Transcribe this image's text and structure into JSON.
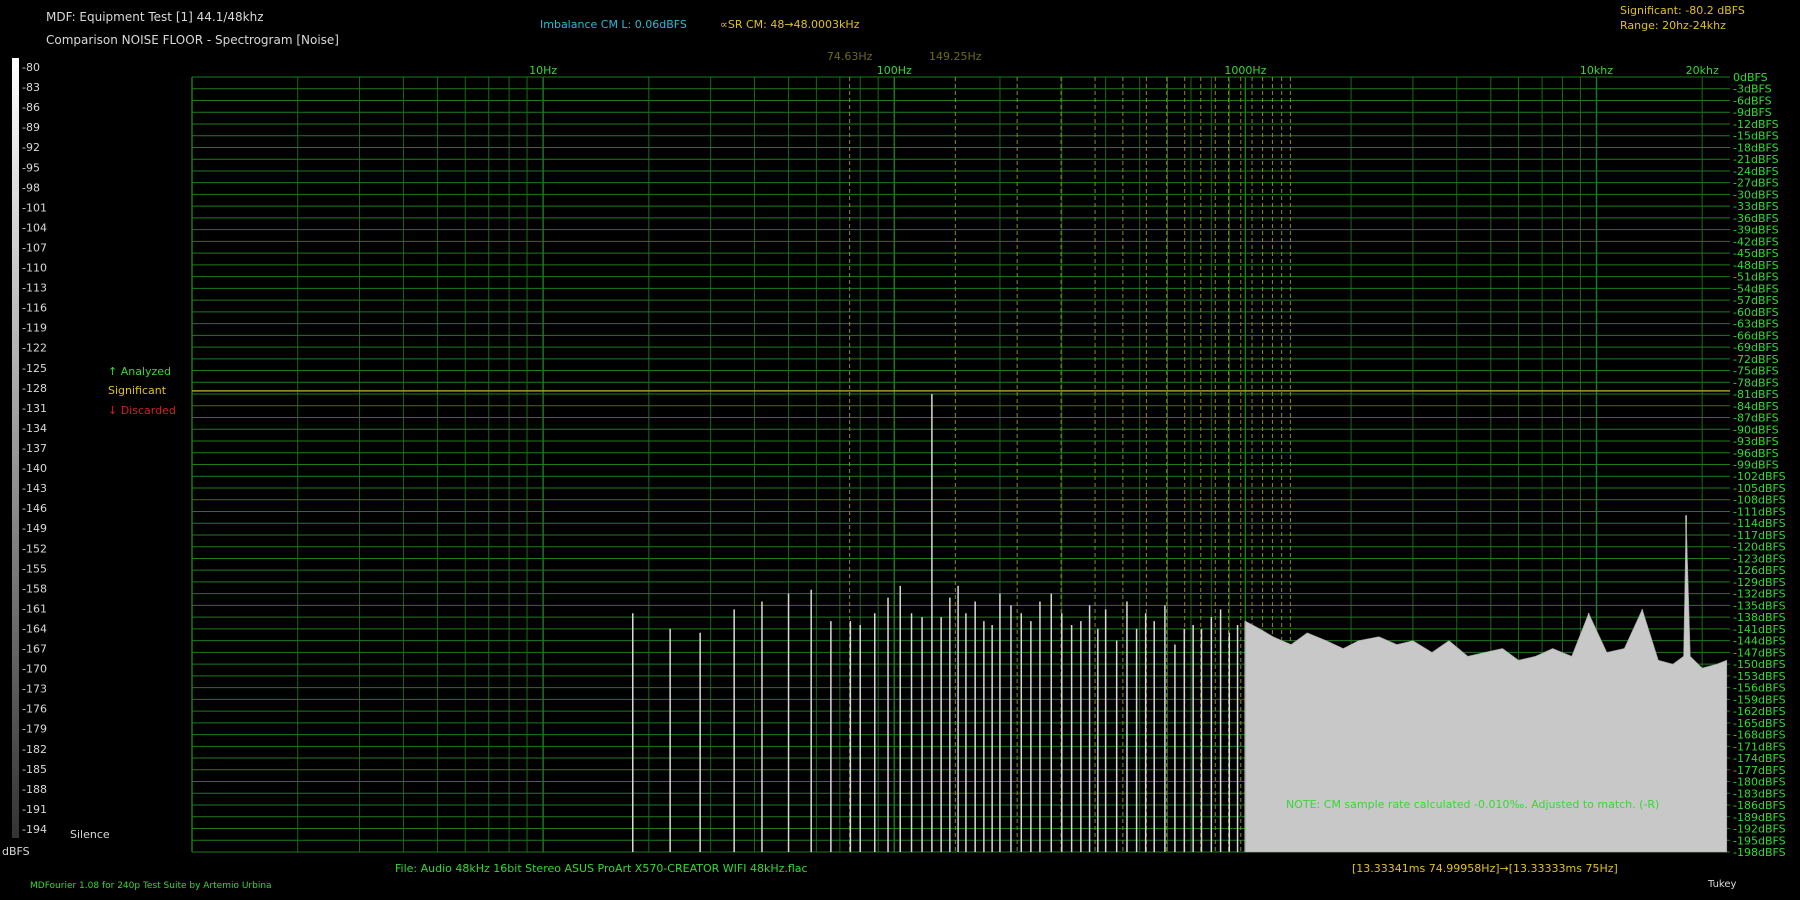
{
  "header": {
    "title": "MDF: Equipment Test [1] 44.1/48khz",
    "subtitle": "Comparison NOISE FLOOR - Spectrogram [Noise]",
    "imbalance": "Imbalance CM L: 0.06dBFS",
    "sr_cm": "∝SR CM: 48→48.0003kHz",
    "significant": "Significant: -80.2 dBFS",
    "range": "Range: 20hz-24khz"
  },
  "legend": {
    "analyzed": "↑ Analyzed",
    "significant": "Significant",
    "discarded": "↓ Discarded",
    "silence": "Silence",
    "unit": "dBFS"
  },
  "footer": {
    "file": "File: Audio   48kHz 16bit Stereo ASUS ProArt X570-CREATOR WIFI 48kHz.flac",
    "range": "[13.33341ms 74.99958Hz]→[13.33333ms 75Hz]",
    "credit": "MDFourier 1.08 for 240p Test Suite by Artemio Urbina",
    "window": "Tukey",
    "note": "NOTE: CM sample rate calculated -0.010‰. Adjusted to match. (-R)"
  },
  "colors": {
    "grid": "#1f7a1f",
    "grid_label": "#34d934",
    "marker": "#8c8c1a",
    "marker_label": "#6b6b14",
    "significant_line": "#a89a2a",
    "bars": "#d9d9d9",
    "title": "#d9d9d9",
    "cyan": "#2fb7d6",
    "yellow": "#e0c020",
    "red": "#d02020"
  },
  "chart_data": {
    "type": "bar",
    "x_scale": "log",
    "xlim": [
      1,
      24000
    ],
    "ylim": [
      -198,
      0
    ],
    "x_tick_labels": [
      {
        "value": 10,
        "label": "10Hz"
      },
      {
        "value": 100,
        "label": "100Hz"
      },
      {
        "value": 1000,
        "label": "1000Hz"
      },
      {
        "value": 10000,
        "label": "10khz"
      },
      {
        "value": 20000,
        "label": "20khz"
      }
    ],
    "marker_labels": [
      {
        "value": 74.63,
        "label": "74.63Hz"
      },
      {
        "value": 149.25,
        "label": "149.25Hz"
      }
    ],
    "significant_level": -80.2,
    "y_right_ticks": [
      "0dBFS",
      "-3dBFS",
      "-6dBFS",
      "-9dBFS",
      "-12dBFS",
      "-15dBFS",
      "-18dBFS",
      "-21dBFS",
      "-24dBFS",
      "-27dBFS",
      "-30dBFS",
      "-33dBFS",
      "-36dBFS",
      "-39dBFS",
      "-42dBFS",
      "-45dBFS",
      "-48dBFS",
      "-51dBFS",
      "-54dBFS",
      "-57dBFS",
      "-60dBFS",
      "-63dBFS",
      "-66dBFS",
      "-69dBFS",
      "-72dBFS",
      "-75dBFS",
      "-78dBFS",
      "-81dBFS",
      "-84dBFS",
      "-87dBFS",
      "-90dBFS",
      "-93dBFS",
      "-96dBFS",
      "-99dBFS",
      "-102dBFS",
      "-105dBFS",
      "-108dBFS",
      "-111dBFS",
      "-114dBFS",
      "-117dBFS",
      "-120dBFS",
      "-123dBFS",
      "-126dBFS",
      "-129dBFS",
      "-132dBFS",
      "-135dBFS",
      "-138dBFS",
      "-141dBFS",
      "-144dBFS",
      "-147dBFS",
      "-150dBFS",
      "-153dBFS",
      "-156dBFS",
      "-159dBFS",
      "-162dBFS",
      "-165dBFS",
      "-168dBFS",
      "-171dBFS",
      "-174dBFS",
      "-177dBFS",
      "-180dBFS",
      "-183dBFS",
      "-186dBFS",
      "-189dBFS",
      "-192dBFS",
      "-195dBFS",
      "-198dBFS"
    ],
    "colorbar_ticks": [
      "-80",
      "-83",
      "-86",
      "-89",
      "-92",
      "-95",
      "-98",
      "-101",
      "-104",
      "-107",
      "-110",
      "-113",
      "-116",
      "-119",
      "-122",
      "-125",
      "-128",
      "-131",
      "-134",
      "-137",
      "-140",
      "-143",
      "-146",
      "-149",
      "-152",
      "-155",
      "-158",
      "-161",
      "-164",
      "-167",
      "-170",
      "-173",
      "-176",
      "-179",
      "-182",
      "-185",
      "-188",
      "-191",
      "-194"
    ],
    "series": [
      {
        "x": [
          18,
          23,
          28,
          35,
          42,
          50,
          58,
          66,
          75,
          80,
          88,
          96,
          104,
          112,
          120,
          128,
          136,
          144,
          152,
          160,
          170,
          180,
          190,
          200,
          215,
          230,
          245,
          260,
          280,
          300,
          320,
          340,
          360,
          380,
          400,
          430,
          460,
          490,
          520,
          550,
          590,
          630,
          670,
          710,
          750,
          800,
          850,
          900,
          950,
          1000,
          1100,
          1200,
          1350,
          1500,
          1700,
          1900,
          2100,
          2400,
          2700,
          3000,
          3400,
          3800,
          4300,
          4800,
          5400,
          6000,
          6700,
          7500,
          8500,
          9500,
          10700,
          12000,
          13500,
          15000,
          16500,
          17700,
          18000,
          18500,
          20000,
          22000,
          23500
        ],
        "y": [
          -137,
          -141,
          -142,
          -136,
          -134,
          -132,
          -131,
          -139,
          -139,
          -140,
          -137,
          -133,
          -130,
          -137,
          -138,
          -81,
          -138,
          -133,
          -130,
          -137,
          -134,
          -139,
          -140,
          -132,
          -135,
          -137,
          -139,
          -134,
          -132,
          -137,
          -140,
          -139,
          -135,
          -141,
          -136,
          -144,
          -134,
          -141,
          -137,
          -139,
          -135,
          -145,
          -141,
          -140,
          -141,
          -138,
          -136,
          -142,
          -140,
          -139,
          -141,
          -143,
          -145,
          -142,
          -144,
          -146,
          -144,
          -143,
          -145,
          -144,
          -147,
          -144,
          -148,
          -147,
          -146,
          -149,
          -148,
          -146,
          -148,
          -137,
          -147,
          -146,
          -136,
          -149,
          -150,
          -148,
          -112,
          -148,
          -151,
          -150,
          -149
        ]
      }
    ]
  }
}
